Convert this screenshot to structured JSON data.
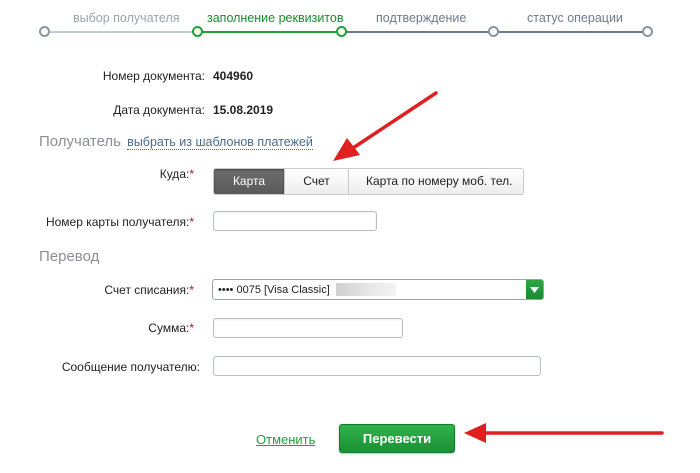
{
  "stepper": {
    "steps": [
      {
        "label": "выбор получателя",
        "state": "done"
      },
      {
        "label": "заполнение реквизитов",
        "state": "active"
      },
      {
        "label": "подтверждение",
        "state": "todo"
      },
      {
        "label": "статус операции",
        "state": "todo"
      }
    ]
  },
  "document": {
    "number_label": "Номер документа:",
    "number_value": "404960",
    "date_label": "Дата документа:",
    "date_value": "15.08.2019"
  },
  "recipient": {
    "title": "Получатель",
    "template_link": "выбрать из шаблонов платежей",
    "where_label": "Куда:",
    "where_options": [
      "Карта",
      "Счет",
      "Карта по номеру моб. тел."
    ],
    "where_selected": "Карта",
    "card_number_label": "Номер карты получателя:",
    "card_number_value": ""
  },
  "transfer": {
    "title": "Перевод",
    "account_label": "Счет списания:",
    "account_value": "•••• 0075  [Visa Classic]",
    "amount_label": "Сумма:",
    "amount_value": "",
    "message_label": "Сообщение получателю:",
    "message_value": ""
  },
  "actions": {
    "cancel_label": "Отменить",
    "submit_label": "Перевести"
  },
  "required_mark": "*",
  "colors": {
    "brand_green": "#21a038",
    "annotation_red": "#e02020",
    "required_red": "#d0021b"
  }
}
